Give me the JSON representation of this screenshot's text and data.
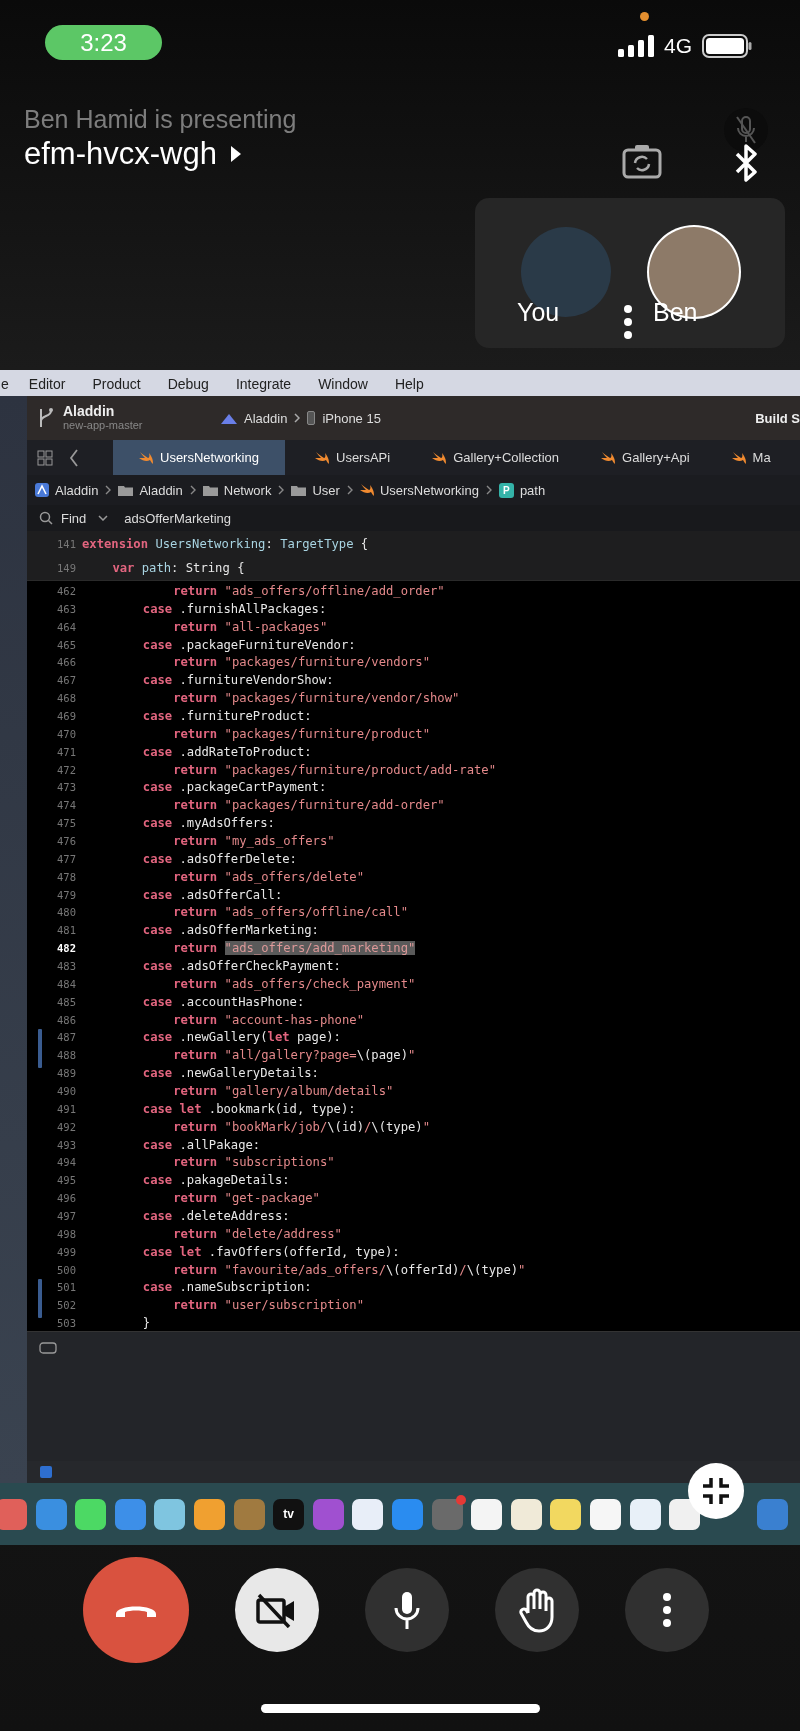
{
  "status_bar": {
    "time": "3:23",
    "network": "4G"
  },
  "meeting": {
    "presenter_text": "Ben Hamid is presenting",
    "code": "efm-hvcx-wgh"
  },
  "participants": [
    {
      "name": "You",
      "ring": false
    },
    {
      "name": "Ben",
      "ring": true
    }
  ],
  "shared_screen": {
    "menu": [
      "e",
      "Editor",
      "Product",
      "Debug",
      "Integrate",
      "Window",
      "Help"
    ],
    "project": {
      "name": "Aladdin",
      "branch": "new-app-master"
    },
    "scheme": {
      "target": "Aladdin",
      "device": "iPhone 15"
    },
    "build_status": "Build S",
    "tabs": [
      {
        "label": "UsersNetworking",
        "selected": true
      },
      {
        "label": "UsersAPi",
        "selected": false
      },
      {
        "label": "Gallery+Collection",
        "selected": false
      },
      {
        "label": "Gallery+Api",
        "selected": false
      },
      {
        "label": "Ma",
        "selected": false
      }
    ],
    "breadcrumbs": [
      {
        "kind": "project",
        "label": "Aladdin"
      },
      {
        "kind": "folder",
        "label": "Aladdin"
      },
      {
        "kind": "folder",
        "label": "Network"
      },
      {
        "kind": "folder",
        "label": "User"
      },
      {
        "kind": "swift",
        "label": "UsersNetworking"
      },
      {
        "kind": "property",
        "letter": "P",
        "label": "path"
      }
    ],
    "find": {
      "mode": "Find",
      "query": "adsOfferMarketing"
    },
    "sticky_header": [
      {
        "number": "141",
        "kind": "extension",
        "tokens": [
          {
            "kind": "keyword",
            "text": "extension"
          },
          {
            "kind": "type",
            "text": " UsersNetworking"
          },
          {
            "kind": "plain",
            "text": ": "
          },
          {
            "kind": "type",
            "text": "TargetType"
          },
          {
            "kind": "plain",
            "text": " {"
          }
        ]
      },
      {
        "number": "149",
        "kind": "property",
        "tokens": [
          {
            "kind": "keyword",
            "text": "var"
          },
          {
            "kind": "type",
            "text": " path"
          },
          {
            "kind": "plain",
            "text": ": String {"
          }
        ]
      }
    ],
    "lines": [
      {
        "number": "462",
        "kind": "return",
        "current": false,
        "changed": false,
        "tokens": [
          {
            "kind": "keyword",
            "text": "return"
          },
          {
            "kind": "string",
            "text": " \"ads_offers/offline/add_order\""
          }
        ]
      },
      {
        "number": "463",
        "kind": "case",
        "current": false,
        "changed": false,
        "tokens": [
          {
            "kind": "keyword",
            "text": "case"
          },
          {
            "kind": "plain",
            "text": " .furnishAllPackages:"
          }
        ]
      },
      {
        "number": "464",
        "kind": "return",
        "current": false,
        "changed": false,
        "tokens": [
          {
            "kind": "keyword",
            "text": "return"
          },
          {
            "kind": "string",
            "text": " \"all-packages\""
          }
        ]
      },
      {
        "number": "465",
        "kind": "case",
        "current": false,
        "changed": false,
        "tokens": [
          {
            "kind": "keyword",
            "text": "case"
          },
          {
            "kind": "plain",
            "text": " .packageFurnitureVendor:"
          }
        ]
      },
      {
        "number": "466",
        "kind": "return",
        "current": false,
        "changed": false,
        "tokens": [
          {
            "kind": "keyword",
            "text": "return"
          },
          {
            "kind": "string",
            "text": " \"packages/furniture/vendors\""
          }
        ]
      },
      {
        "number": "467",
        "kind": "case",
        "current": false,
        "changed": false,
        "tokens": [
          {
            "kind": "keyword",
            "text": "case"
          },
          {
            "kind": "plain",
            "text": " .furnitureVendorShow:"
          }
        ]
      },
      {
        "number": "468",
        "kind": "return",
        "current": false,
        "changed": false,
        "tokens": [
          {
            "kind": "keyword",
            "text": "return"
          },
          {
            "kind": "string",
            "text": " \"packages/furniture/vendor/show\""
          }
        ]
      },
      {
        "number": "469",
        "kind": "case",
        "current": false,
        "changed": false,
        "tokens": [
          {
            "kind": "keyword",
            "text": "case"
          },
          {
            "kind": "plain",
            "text": " .furnitureProduct:"
          }
        ]
      },
      {
        "number": "470",
        "kind": "return",
        "current": false,
        "changed": false,
        "tokens": [
          {
            "kind": "keyword",
            "text": "return"
          },
          {
            "kind": "string",
            "text": " \"packages/furniture/product\""
          }
        ]
      },
      {
        "number": "471",
        "kind": "case",
        "current": false,
        "changed": false,
        "tokens": [
          {
            "kind": "keyword",
            "text": "case"
          },
          {
            "kind": "plain",
            "text": " .addRateToProduct:"
          }
        ]
      },
      {
        "number": "472",
        "kind": "return",
        "current": false,
        "changed": false,
        "tokens": [
          {
            "kind": "keyword",
            "text": "return"
          },
          {
            "kind": "string",
            "text": " \"packages/furniture/product/add-rate\""
          }
        ]
      },
      {
        "number": "473",
        "kind": "case",
        "current": false,
        "changed": false,
        "tokens": [
          {
            "kind": "keyword",
            "text": "case"
          },
          {
            "kind": "plain",
            "text": " .packageCartPayment:"
          }
        ]
      },
      {
        "number": "474",
        "kind": "return",
        "current": false,
        "changed": false,
        "tokens": [
          {
            "kind": "keyword",
            "text": "return"
          },
          {
            "kind": "string",
            "text": " \"packages/furniture/add-order\""
          }
        ]
      },
      {
        "number": "475",
        "kind": "case",
        "current": false,
        "changed": false,
        "tokens": [
          {
            "kind": "keyword",
            "text": "case"
          },
          {
            "kind": "plain",
            "text": " .myAdsOffers:"
          }
        ]
      },
      {
        "number": "476",
        "kind": "return",
        "current": false,
        "changed": false,
        "tokens": [
          {
            "kind": "keyword",
            "text": "return"
          },
          {
            "kind": "string",
            "text": " \"my_ads_offers\""
          }
        ]
      },
      {
        "number": "477",
        "kind": "case",
        "current": false,
        "changed": false,
        "tokens": [
          {
            "kind": "keyword",
            "text": "case"
          },
          {
            "kind": "plain",
            "text": " .adsOfferDelete:"
          }
        ]
      },
      {
        "number": "478",
        "kind": "return",
        "current": false,
        "changed": false,
        "tokens": [
          {
            "kind": "keyword",
            "text": "return"
          },
          {
            "kind": "string",
            "text": " \"ads_offers/delete\""
          }
        ]
      },
      {
        "number": "479",
        "kind": "case",
        "current": false,
        "changed": false,
        "tokens": [
          {
            "kind": "keyword",
            "text": "case"
          },
          {
            "kind": "plain",
            "text": " .adsOfferCall:"
          }
        ]
      },
      {
        "number": "480",
        "kind": "return",
        "current": false,
        "changed": false,
        "tokens": [
          {
            "kind": "keyword",
            "text": "return"
          },
          {
            "kind": "string",
            "text": " \"ads_offers/offline/call\""
          }
        ]
      },
      {
        "number": "481",
        "kind": "case",
        "current": false,
        "changed": false,
        "tokens": [
          {
            "kind": "keyword",
            "text": "case"
          },
          {
            "kind": "plain",
            "text": " .adsOfferMarketing:"
          }
        ]
      },
      {
        "number": "482",
        "kind": "return",
        "current": true,
        "changed": false,
        "tokens": [
          {
            "kind": "keyword",
            "text": "return"
          },
          {
            "kind": "match",
            "text": "\"ads_offers/add_marketing\""
          }
        ]
      },
      {
        "number": "483",
        "kind": "case",
        "current": false,
        "changed": false,
        "tokens": [
          {
            "kind": "keyword",
            "text": "case"
          },
          {
            "kind": "plain",
            "text": " .adsOfferCheckPayment:"
          }
        ]
      },
      {
        "number": "484",
        "kind": "return",
        "current": false,
        "changed": false,
        "tokens": [
          {
            "kind": "keyword",
            "text": "return"
          },
          {
            "kind": "string",
            "text": " \"ads_offers/check_payment\""
          }
        ]
      },
      {
        "number": "485",
        "kind": "case",
        "current": false,
        "changed": false,
        "tokens": [
          {
            "kind": "keyword",
            "text": "case"
          },
          {
            "kind": "plain",
            "text": " .accountHasPhone:"
          }
        ]
      },
      {
        "number": "486",
        "kind": "return",
        "current": false,
        "changed": false,
        "tokens": [
          {
            "kind": "keyword",
            "text": "return"
          },
          {
            "kind": "string",
            "text": " \"account-has-phone\""
          }
        ]
      },
      {
        "number": "487",
        "kind": "case",
        "current": false,
        "changed": true,
        "tokens": [
          {
            "kind": "keyword",
            "text": "case"
          },
          {
            "kind": "plain",
            "text": " .newGallery("
          },
          {
            "kind": "keyword",
            "text": "let"
          },
          {
            "kind": "plain",
            "text": " page):"
          }
        ]
      },
      {
        "number": "488",
        "kind": "return",
        "current": false,
        "changed": true,
        "tokens": [
          {
            "kind": "keyword",
            "text": "return"
          },
          {
            "kind": "string",
            "text": " \"all/gallery?page="
          },
          {
            "kind": "plain",
            "text": "\\(page)"
          },
          {
            "kind": "string",
            "text": "\""
          }
        ]
      },
      {
        "number": "489",
        "kind": "case",
        "current": false,
        "changed": false,
        "tokens": [
          {
            "kind": "keyword",
            "text": "case"
          },
          {
            "kind": "plain",
            "text": " .newGalleryDetails:"
          }
        ]
      },
      {
        "number": "490",
        "kind": "return",
        "current": false,
        "changed": false,
        "tokens": [
          {
            "kind": "keyword",
            "text": "return"
          },
          {
            "kind": "string",
            "text": " \"gallery/album/details\""
          }
        ]
      },
      {
        "number": "491",
        "kind": "case",
        "current": false,
        "changed": false,
        "tokens": [
          {
            "kind": "keyword",
            "text": "case let"
          },
          {
            "kind": "plain",
            "text": " .bookmark(id, type):"
          }
        ]
      },
      {
        "number": "492",
        "kind": "return",
        "current": false,
        "changed": false,
        "tokens": [
          {
            "kind": "keyword",
            "text": "return"
          },
          {
            "kind": "string",
            "text": " \"bookMark/job/"
          },
          {
            "kind": "plain",
            "text": "\\(id)"
          },
          {
            "kind": "string",
            "text": "/"
          },
          {
            "kind": "plain",
            "text": "\\(type)"
          },
          {
            "kind": "string",
            "text": "\""
          }
        ]
      },
      {
        "number": "493",
        "kind": "case",
        "current": false,
        "changed": false,
        "tokens": [
          {
            "kind": "keyword",
            "text": "case"
          },
          {
            "kind": "plain",
            "text": " .allPakage:"
          }
        ]
      },
      {
        "number": "494",
        "kind": "return",
        "current": false,
        "changed": false,
        "tokens": [
          {
            "kind": "keyword",
            "text": "return"
          },
          {
            "kind": "string",
            "text": " \"subscriptions\""
          }
        ]
      },
      {
        "number": "495",
        "kind": "case",
        "current": false,
        "changed": false,
        "tokens": [
          {
            "kind": "keyword",
            "text": "case"
          },
          {
            "kind": "plain",
            "text": " .pakageDetails:"
          }
        ]
      },
      {
        "number": "496",
        "kind": "return",
        "current": false,
        "changed": false,
        "tokens": [
          {
            "kind": "keyword",
            "text": "return"
          },
          {
            "kind": "string",
            "text": " \"get-package\""
          }
        ]
      },
      {
        "number": "497",
        "kind": "case",
        "current": false,
        "changed": false,
        "tokens": [
          {
            "kind": "keyword",
            "text": "case"
          },
          {
            "kind": "plain",
            "text": " .deleteAddress:"
          }
        ]
      },
      {
        "number": "498",
        "kind": "return",
        "current": false,
        "changed": false,
        "tokens": [
          {
            "kind": "keyword",
            "text": "return"
          },
          {
            "kind": "string",
            "text": " \"delete/address\""
          }
        ]
      },
      {
        "number": "499",
        "kind": "case",
        "current": false,
        "changed": false,
        "tokens": [
          {
            "kind": "keyword",
            "text": "case let"
          },
          {
            "kind": "plain",
            "text": " .favOffers(offerId, type):"
          }
        ]
      },
      {
        "number": "500",
        "kind": "return",
        "current": false,
        "changed": false,
        "tokens": [
          {
            "kind": "keyword",
            "text": "return"
          },
          {
            "kind": "string",
            "text": " \"favourite/ads_offers/"
          },
          {
            "kind": "plain",
            "text": "\\(offerId)"
          },
          {
            "kind": "string",
            "text": "/"
          },
          {
            "kind": "plain",
            "text": "\\(type)"
          },
          {
            "kind": "string",
            "text": "\""
          }
        ]
      },
      {
        "number": "501",
        "kind": "case",
        "current": false,
        "changed": true,
        "tokens": [
          {
            "kind": "keyword",
            "text": "case"
          },
          {
            "kind": "plain",
            "text": " .nameSubscription:"
          }
        ]
      },
      {
        "number": "502",
        "kind": "return",
        "current": false,
        "changed": true,
        "tokens": [
          {
            "kind": "keyword",
            "text": "return"
          },
          {
            "kind": "string",
            "text": " \"user/subscription\""
          }
        ]
      },
      {
        "number": "503",
        "kind": "close",
        "current": false,
        "changed": false,
        "tokens": [
          {
            "kind": "plain",
            "text": "}"
          }
        ]
      }
    ],
    "dock": [
      {
        "color": "#e0605a",
        "badge": false
      },
      {
        "color": "#3a8fe0",
        "badge": false
      },
      {
        "color": "#4cd964",
        "badge": false
      },
      {
        "color": "#3d8fe8",
        "badge": false
      },
      {
        "color": "#7fc5e0",
        "badge": false
      },
      {
        "color": "#f0a030",
        "badge": false
      },
      {
        "color": "#a07a40",
        "badge": false
      },
      {
        "color": "#111111",
        "badge": false,
        "label": "tv"
      },
      {
        "color": "#a050d0",
        "badge": false
      },
      {
        "color": "#e8eef8",
        "badge": false
      },
      {
        "color": "#2a8cf0",
        "badge": false
      },
      {
        "color": "#6a6a6a",
        "badge": true
      },
      {
        "color": "#f4f4f4",
        "badge": false
      },
      {
        "color": "#f0ead8",
        "badge": false
      },
      {
        "color": "#f2d860",
        "badge": false
      },
      {
        "color": "#f6f6f6",
        "badge": false
      },
      {
        "color": "#e8f0f8",
        "badge": false
      },
      {
        "color": "#f0f0f0",
        "badge": false
      },
      {
        "color": "#3a80d0",
        "badge": false
      }
    ]
  },
  "controls": [
    {
      "kind": "end-call"
    },
    {
      "kind": "camera",
      "on": false
    },
    {
      "kind": "mic",
      "on": true
    },
    {
      "kind": "hand"
    },
    {
      "kind": "more"
    }
  ]
}
